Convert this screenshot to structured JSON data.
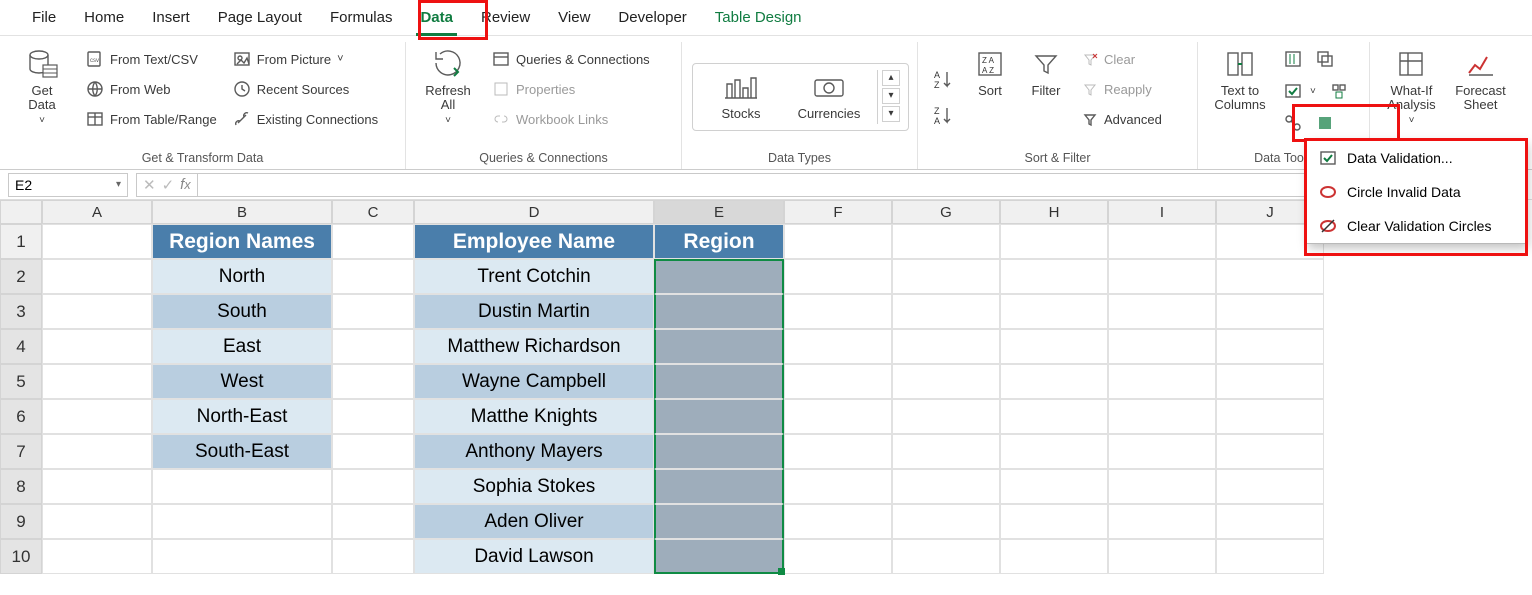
{
  "tabs": {
    "file": "File",
    "home": "Home",
    "insert": "Insert",
    "pagelayout": "Page Layout",
    "formulas": "Formulas",
    "data": "Data",
    "review": "Review",
    "view": "View",
    "developer": "Developer",
    "tabledesign": "Table Design"
  },
  "ribbon": {
    "get_data": "Get\nData",
    "from_text_csv": "From Text/CSV",
    "from_web": "From Web",
    "from_table_range": "From Table/Range",
    "from_picture": "From Picture",
    "recent_sources": "Recent Sources",
    "existing_connections": "Existing Connections",
    "group_get_transform": "Get & Transform Data",
    "refresh_all": "Refresh\nAll",
    "queries_connections": "Queries & Connections",
    "properties": "Properties",
    "workbook_links": "Workbook Links",
    "group_qc": "Queries & Connections",
    "stocks": "Stocks",
    "currencies": "Currencies",
    "group_datatypes": "Data Types",
    "sort": "Sort",
    "filter": "Filter",
    "clear": "Clear",
    "reapply": "Reapply",
    "advanced": "Advanced",
    "group_sortfilter": "Sort & Filter",
    "text_to_columns": "Text to\nColumns",
    "group_datatools": "Data Tools",
    "whatif": "What-If\nAnalysis",
    "forecast_sheet": "Forecast\nSheet",
    "data_validation_btn": "Data Validation"
  },
  "dv_menu": {
    "data_validation": "Data Validation...",
    "circle_invalid": "Circle Invalid Data",
    "clear_circles": "Clear Validation Circles"
  },
  "namebox": "E2",
  "columns": [
    "A",
    "B",
    "C",
    "D",
    "E",
    "F",
    "G",
    "H",
    "I",
    "J"
  ],
  "rows": [
    "1",
    "2",
    "3",
    "4",
    "5",
    "6",
    "7",
    "8",
    "9",
    "10"
  ],
  "table_b_header": "Region Names",
  "table_b": [
    "North",
    "South",
    "East",
    "West",
    "North-East",
    "South-East"
  ],
  "table_d_header": "Employee Name",
  "table_e_header": "Region",
  "table_d": [
    "Trent Cotchin",
    "Dustin Martin",
    "Matthew Richardson",
    "Wayne Campbell",
    "Matthe Knights",
    "Anthony Mayers",
    "Sophia Stokes",
    "Aden Oliver",
    "David Lawson"
  ]
}
